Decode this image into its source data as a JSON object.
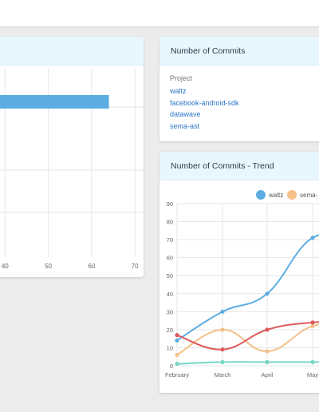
{
  "project_card": {
    "title": "Number of Commits",
    "label": "Project",
    "projects": [
      "waltz",
      "facebook-android-sdk",
      "datawave",
      "sema-ast"
    ]
  },
  "trend_card": {
    "title": "Number of Commits - Trend"
  },
  "colors": {
    "waltz": "#5dade2",
    "sema_ast": "#f5c08a",
    "red_series": "#dd5b5b",
    "teal_series": "#76d7c4",
    "bar": "#5dade2",
    "grid": "#e6e6e6"
  },
  "chart_data": [
    {
      "type": "bar",
      "orientation": "horizontal",
      "x_ticks": [
        "40",
        "50",
        "60",
        "70"
      ],
      "visible_x_range": [
        37,
        72
      ],
      "bars": [
        {
          "value": 64
        }
      ]
    },
    {
      "type": "line",
      "categories": [
        "February",
        "March",
        "April",
        "May"
      ],
      "ylim": [
        0,
        90
      ],
      "y_ticks": [
        "0",
        "10",
        "20",
        "30",
        "40",
        "50",
        "60",
        "70",
        "80",
        "90"
      ],
      "legend": [
        "waltz",
        "sema-"
      ],
      "legend_position": "top",
      "series": [
        {
          "name": "waltz",
          "color_key": "waltz",
          "values": [
            14,
            30,
            40,
            71,
            69
          ]
        },
        {
          "name": "sema-",
          "color_key": "sema_ast",
          "values": [
            6,
            20,
            8,
            22,
            24
          ]
        },
        {
          "color_key": "red_series",
          "values": [
            17,
            9,
            20,
            24,
            25
          ]
        },
        {
          "color_key": "teal_series",
          "values": [
            1,
            2,
            2,
            2,
            2
          ]
        }
      ]
    }
  ]
}
